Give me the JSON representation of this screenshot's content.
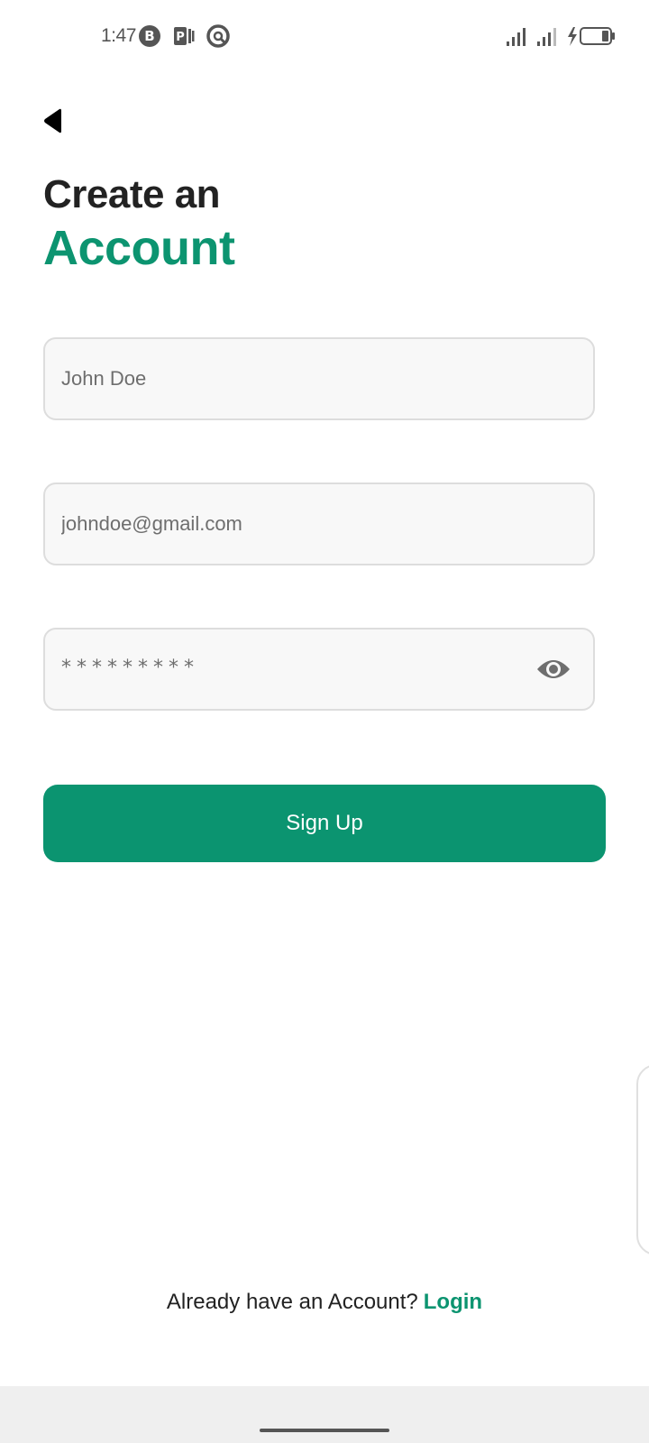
{
  "status_bar": {
    "time": "1:47",
    "icons": [
      "b-badge-icon",
      "p-app-icon",
      "no-disturb-icon"
    ],
    "right_icons": [
      "signal-icon",
      "signal-icon-2",
      "charging-icon",
      "battery-icon"
    ]
  },
  "header": {
    "back_icon": "back-triangle-icon",
    "title_line1": "Create an",
    "title_line2": "Account"
  },
  "form": {
    "name_placeholder": "John Doe",
    "email_placeholder": "johndoe@gmail.com",
    "password_mask": "*********",
    "password_toggle_icon": "eye-icon",
    "signup_label": "Sign Up"
  },
  "footer": {
    "prompt": "Already have an Account?",
    "login_label": "Login"
  },
  "colors": {
    "accent": "#0b9470",
    "text": "#222222",
    "field_bg": "#f8f8f8",
    "field_border": "#dddddd"
  }
}
